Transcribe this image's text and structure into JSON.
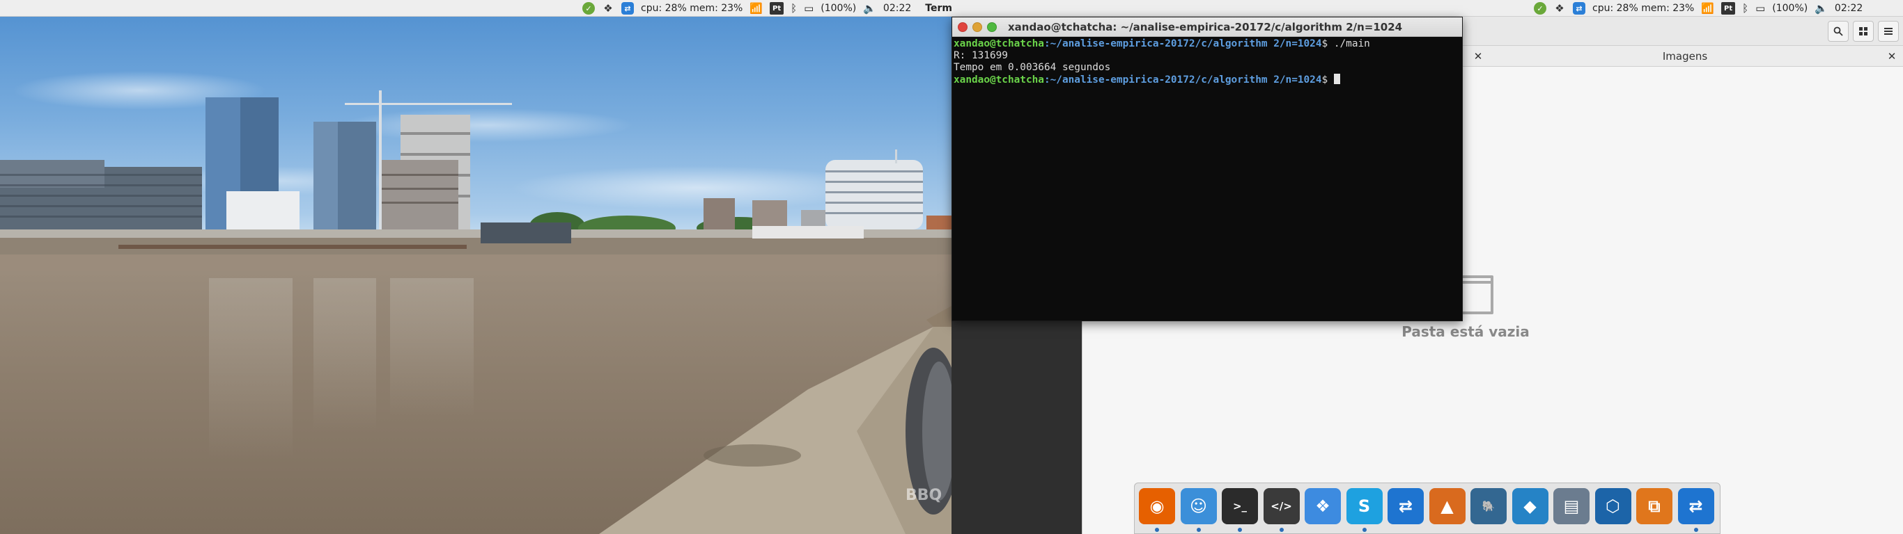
{
  "left_panel": {
    "stats": "cpu: 28% mem: 23%",
    "lang": "Pt",
    "battery": "(100%)",
    "time": "02:22",
    "active_app": "Terminal"
  },
  "right_panel": {
    "stats": "cpu: 28% mem: 23%",
    "lang": "Pt",
    "battery": "(100%)",
    "time": "02:22"
  },
  "wallpaper": {
    "watermark": "BBQ"
  },
  "terminal": {
    "title": "xandao@tchatcha: ~/analise-empirica-20172/c/algorithm 2/n=1024",
    "lines": [
      {
        "user": "xandao@tchatcha",
        "path": ":~/analise-empirica-20172/c/algorithm 2/n=1024",
        "cmd": "$ ./main"
      },
      {
        "text": "R: 131699"
      },
      {
        "text": "Tempo em 0.003664 segundos"
      },
      {
        "user": "xandao@tchatcha",
        "path": ":~/analise-empirica-20172/c/algorithm 2/n=1024",
        "cmd": "$ "
      }
    ]
  },
  "file_manager": {
    "tab_label": "Imagens",
    "empty_message": "Pasta está vazia"
  },
  "dock": {
    "items": [
      {
        "name": "firefox-icon",
        "color": "#e66000",
        "running": true
      },
      {
        "name": "finder-icon",
        "color": "#3b8fd9",
        "running": true
      },
      {
        "name": "terminal-icon",
        "color": "#2b2b2b",
        "running": true
      },
      {
        "name": "code-editor-icon",
        "color": "#3a3a3a",
        "running": true
      },
      {
        "name": "dropbox-icon",
        "color": "#3d8be0",
        "running": false
      },
      {
        "name": "skype-icon",
        "color": "#1ea1e0",
        "running": true
      },
      {
        "name": "teamviewer-icon",
        "color": "#1e74d0",
        "running": false
      },
      {
        "name": "matlab-icon",
        "color": "#d96a1e",
        "running": false
      },
      {
        "name": "postgresql-icon",
        "color": "#336791",
        "running": false
      },
      {
        "name": "mysql-workbench-icon",
        "color": "#2583c6",
        "running": false
      },
      {
        "name": "network-tool-icon",
        "color": "#6b7c8f",
        "running": false
      },
      {
        "name": "virtualbox-icon",
        "color": "#1c64a8",
        "running": false
      },
      {
        "name": "diagram-tool-icon",
        "color": "#e0761c",
        "running": false
      },
      {
        "name": "teamviewer-2-icon",
        "color": "#1e74d0",
        "running": true
      }
    ]
  }
}
